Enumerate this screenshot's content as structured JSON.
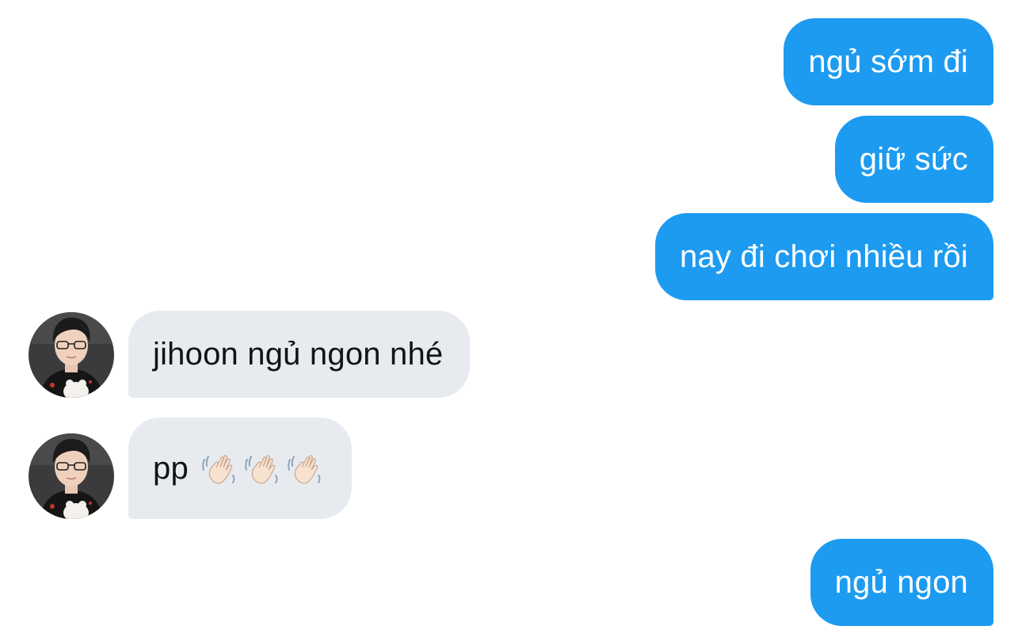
{
  "messages": {
    "m1": {
      "text": "ngủ sớm đi"
    },
    "m2": {
      "text": "giữ sức"
    },
    "m3": {
      "text": "nay đi chơi nhiều rồi"
    },
    "m4": {
      "text": "jihoon ngủ ngon nhé"
    },
    "m5": {
      "text": "pp",
      "emoji": [
        "waving-hand-icon",
        "waving-hand-icon",
        "waving-hand-icon"
      ]
    },
    "m6": {
      "text": "ngủ ngon"
    }
  },
  "colors": {
    "outgoing_bubble": "#1d9bf0",
    "incoming_bubble": "#e7ebef",
    "outgoing_text": "#ffffff",
    "incoming_text": "#0f1419"
  }
}
